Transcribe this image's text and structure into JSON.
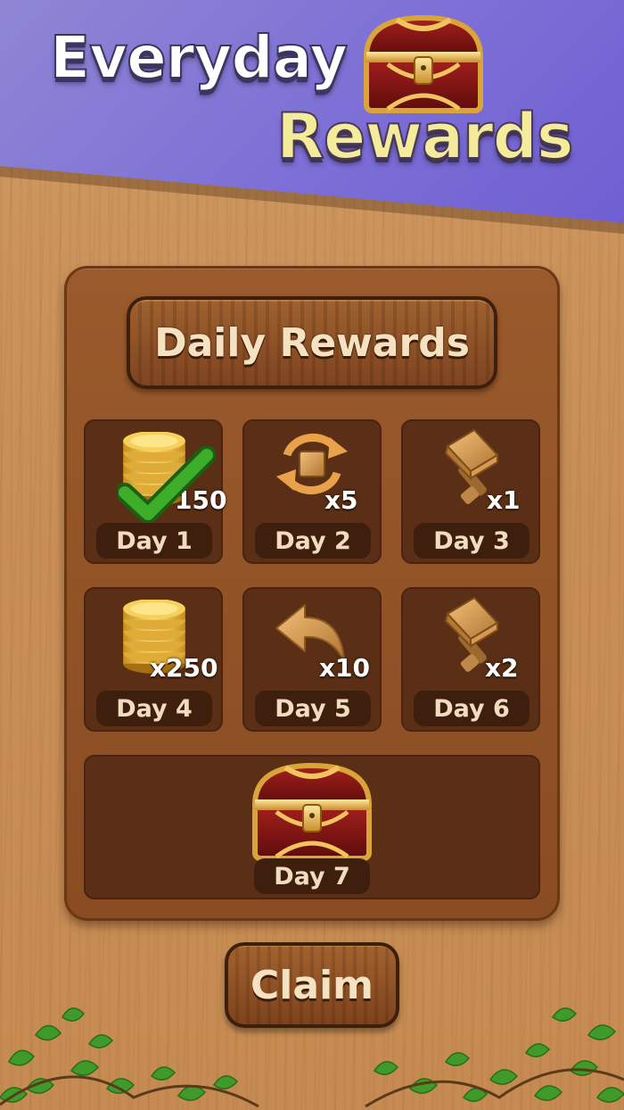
{
  "header": {
    "title_line1": "Everyday",
    "title_line2": "Rewards",
    "icon": "treasure-chest-icon"
  },
  "panel": {
    "title": "Daily Rewards"
  },
  "days": [
    {
      "label": "Day 1",
      "reward": "coins-icon",
      "count": "150",
      "claimed": true
    },
    {
      "label": "Day 2",
      "reward": "shuffle-icon",
      "count": "x5",
      "claimed": false
    },
    {
      "label": "Day 3",
      "reward": "hammer-icon",
      "count": "x1",
      "claimed": false
    },
    {
      "label": "Day 4",
      "reward": "coins-icon",
      "count": "x250",
      "claimed": false
    },
    {
      "label": "Day 5",
      "reward": "undo-arrow-icon",
      "count": "x10",
      "claimed": false
    },
    {
      "label": "Day 6",
      "reward": "hammer-icon",
      "count": "x2",
      "claimed": false
    },
    {
      "label": "Day 7",
      "reward": "treasure-chest-icon",
      "count": "",
      "claimed": false
    }
  ],
  "claim_button": {
    "label": "Claim"
  },
  "colors": {
    "banner": "#7d6fd6",
    "wood": "#c98f57",
    "title_yellow": "#f4ec9a",
    "check_green": "#3dad2a"
  }
}
